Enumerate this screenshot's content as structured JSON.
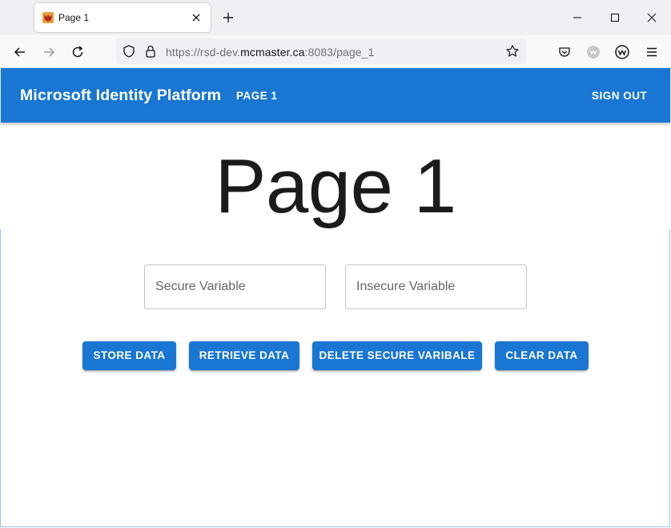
{
  "browser": {
    "tab": {
      "title": "Page 1",
      "favicon": "shield-fox-favicon"
    },
    "url": {
      "prefix": "https://rsd-dev.",
      "domain": "mcmaster.ca",
      "suffix": ":8083/page_1"
    },
    "icons": [
      "back-icon",
      "forward-icon",
      "reload-icon",
      "shield-icon",
      "lock-icon",
      "star-icon",
      "pocket-icon",
      "extension-icon",
      "account-icon",
      "menu-icon"
    ]
  },
  "app": {
    "title": "Microsoft Identity Platform",
    "nav_page1": "PAGE 1",
    "sign_out": "SIGN OUT",
    "heading": "Page 1",
    "fields": {
      "secure_placeholder": "Secure Variable",
      "insecure_placeholder": "Insecure Variable"
    },
    "buttons": {
      "store": "STORE DATA",
      "retrieve": "RETRIEVE DATA",
      "delete_secure": "DELETE SECURE VARIBALE",
      "clear": "CLEAR DATA"
    },
    "colors": {
      "primary": "#1976d2",
      "tabstrip": "#f0f0f4"
    }
  }
}
